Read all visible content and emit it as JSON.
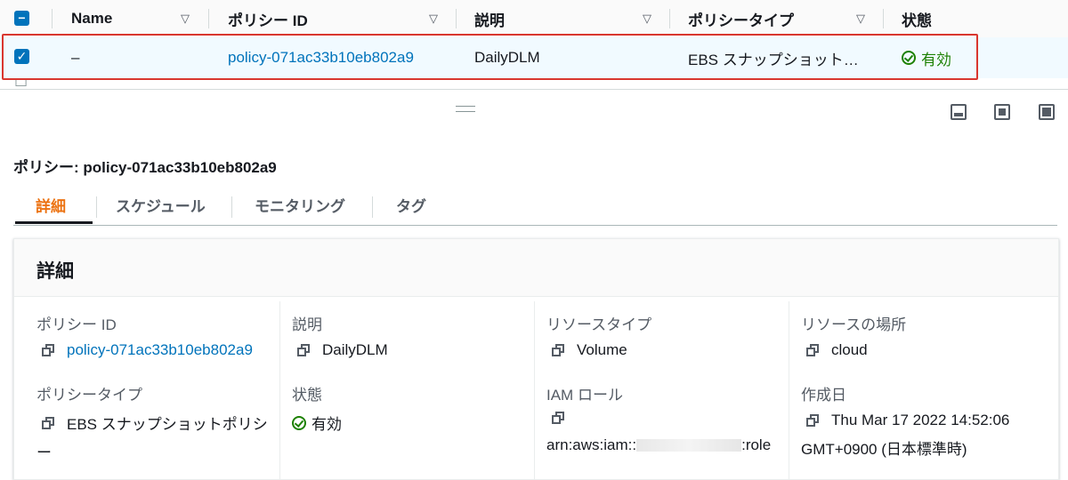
{
  "table": {
    "headers": [
      "Name",
      "ポリシー ID",
      "説明",
      "ポリシータイプ",
      "状態"
    ],
    "selected_row": {
      "name": "–",
      "policy_id": "policy-071ac33b10eb802a9",
      "description": "DailyDLM",
      "policy_type": "EBS スナップショット…",
      "status": "有効"
    }
  },
  "panel": {
    "title": "ポリシー: policy-071ac33b10eb802a9",
    "tabs": [
      "詳細",
      "スケジュール",
      "モニタリング",
      "タグ"
    ],
    "card_title": "詳細",
    "fields": {
      "policy_id_label": "ポリシー ID",
      "policy_id_value": "policy-071ac33b10eb802a9",
      "description_label": "説明",
      "description_value": "DailyDLM",
      "resource_type_label": "リソースタイプ",
      "resource_type_value": "Volume",
      "resource_location_label": "リソースの場所",
      "resource_location_value": "cloud",
      "policy_type_label": "ポリシータイプ",
      "policy_type_value_line1": "EBS スナップショットポリシ",
      "policy_type_value_line2": "ー",
      "status_label": "状態",
      "status_value": "有効",
      "iam_role_label": "IAM ロール",
      "iam_role_prefix": "arn:aws:iam::",
      "iam_role_suffix": ":role",
      "created_label": "作成日",
      "created_value_line1": "Thu Mar 17 2022 14:52:06",
      "created_value_line2": "GMT+0900 (日本標準時)"
    }
  },
  "colors": {
    "accent": "#0073bb",
    "active_tab": "#ec7211",
    "status_ok": "#1d8102",
    "selection_outline": "#d9372f"
  }
}
